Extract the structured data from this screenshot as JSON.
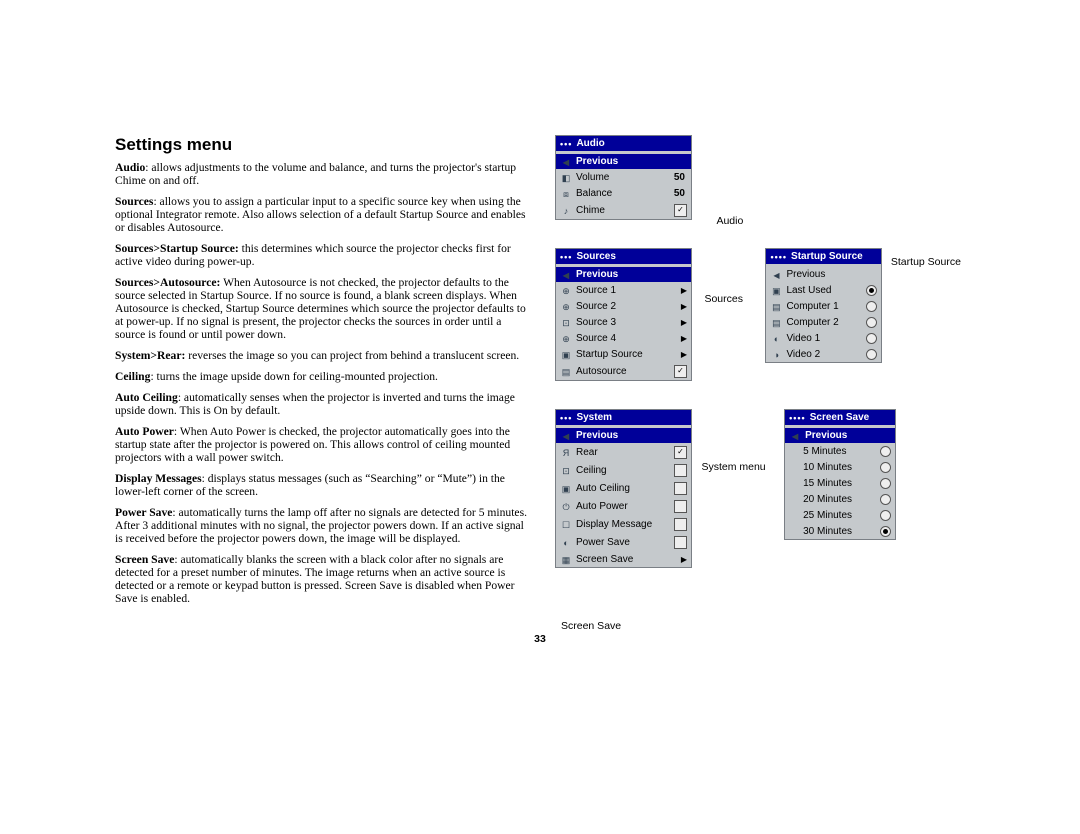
{
  "title": "Settings menu",
  "paragraphs": {
    "audio": "Audio: allows adjustments to the volume and balance, and turns the projector's startup Chime on and off.",
    "sources": "Sources: allows you to assign a particular input to a specific source key when using the optional Integrator remote. Also allows selection of a default Startup Source and enables or disables Autosource.",
    "startup_source": "Sources>Startup Source: this determines which source the projector checks first for active video during power-up.",
    "autosource": "Sources>Autosource: When Autosource is not checked, the projector defaults to the source selected in Startup Source. If no source is found, a blank screen displays. When Autosource is checked, Startup Source determines which source the projector defaults to at power-up. If no signal is present, the projector checks the sources in order until a source is found or until power down.",
    "rear": "System>Rear: reverses the image so you can project from behind a translucent screen.",
    "ceiling": "Ceiling: turns the image upside down for ceiling-mounted projection.",
    "auto_ceiling": "Auto Ceiling: automatically senses when the projector is inverted and turns the image upside down. This is On by default.",
    "auto_power": "Auto Power: When Auto Power is checked, the projector automatically goes into the startup state after the projector is powered on. This allows control of ceiling mounted projectors with a wall power switch.",
    "display_messages": "Display Messages: displays status messages (such as \"Searching\" or \"Mute\") in the lower-left corner of the screen.",
    "power_save": "Power Save: automatically turns the lamp off after no signals are detected for 5 minutes. After 3 additional minutes with no signal, the projector powers down. If an active signal is received before the projector powers down, the image will be displayed.",
    "screen_save": "Screen Save: automatically blanks the screen with a black color after no signals are detected for a preset number of minutes. The image returns when an active source is detected or a remote or keypad button is pressed. Screen Save is disabled when Power Save is enabled."
  },
  "page_number": "33",
  "captions": {
    "audio": "Audio",
    "sources": "Sources",
    "startup_source": "Startup Source",
    "system_menu": "System menu",
    "screen_save": "Screen Save"
  },
  "menus": {
    "audio": {
      "title": "Audio",
      "prev": "Previous",
      "volume_label": "Volume",
      "volume_value": "50",
      "balance_label": "Balance",
      "balance_value": "50",
      "chime_label": "Chime",
      "chime_checked": true
    },
    "sources": {
      "title": "Sources",
      "prev": "Previous",
      "items": [
        {
          "label": "Source 1"
        },
        {
          "label": "Source 2"
        },
        {
          "label": "Source 3"
        },
        {
          "label": "Source 4"
        },
        {
          "label": "Startup Source"
        }
      ],
      "autosource_label": "Autosource",
      "autosource_checked": true
    },
    "startup_source": {
      "title": "Startup Source",
      "prev": "Previous",
      "items": [
        {
          "label": "Last Used",
          "selected": true
        },
        {
          "label": "Computer 1",
          "selected": false
        },
        {
          "label": "Computer 2",
          "selected": false
        },
        {
          "label": "Video 1",
          "selected": false
        },
        {
          "label": "Video 2",
          "selected": false
        }
      ]
    },
    "system": {
      "title": "System",
      "prev": "Previous",
      "items": [
        {
          "label": "Rear",
          "checked": true
        },
        {
          "label": "Ceiling",
          "checked": false
        },
        {
          "label": "Auto Ceiling",
          "checked": false
        },
        {
          "label": "Auto Power",
          "checked": false
        },
        {
          "label": "Display Message",
          "checked": false
        },
        {
          "label": "Power Save",
          "checked": false
        }
      ],
      "screen_save_label": "Screen Save"
    },
    "screen_save": {
      "title": "Screen Save",
      "prev": "Previous",
      "items": [
        {
          "label": "5 Minutes",
          "selected": false
        },
        {
          "label": "10 Minutes",
          "selected": false
        },
        {
          "label": "15 Minutes",
          "selected": false
        },
        {
          "label": "20 Minutes",
          "selected": false
        },
        {
          "label": "25 Minutes",
          "selected": false
        },
        {
          "label": "30 Minutes",
          "selected": true
        }
      ]
    }
  }
}
